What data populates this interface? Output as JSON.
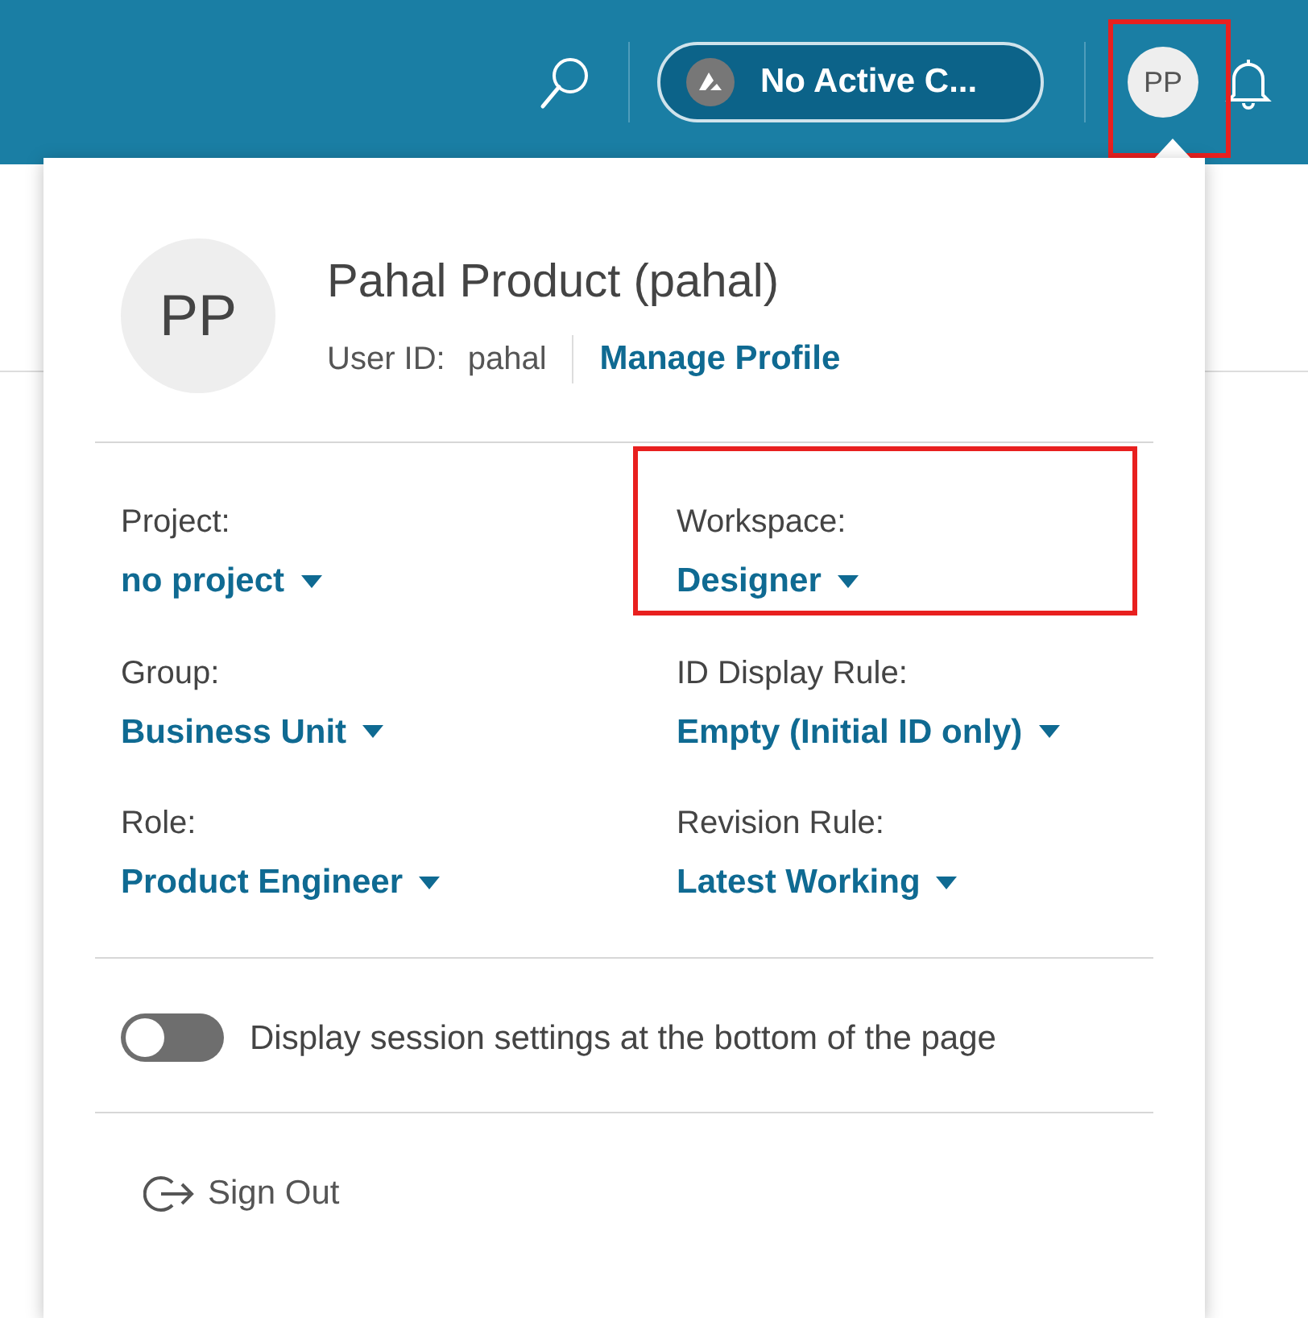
{
  "header": {
    "context_chip": {
      "label": "No Active C..."
    },
    "user_avatar": {
      "initials": "PP",
      "highlighted": true
    }
  },
  "profile": {
    "initials": "PP",
    "name": "Pahal Product (pahal)",
    "user_id_label": "User ID:",
    "user_id": "pahal",
    "manage_link": "Manage Profile"
  },
  "settings": [
    {
      "label": "Project:",
      "value": "no project",
      "highlighted": false
    },
    {
      "label": "Workspace:",
      "value": "Designer",
      "highlighted": true
    },
    {
      "label": "Group:",
      "value": "Business Unit",
      "highlighted": false
    },
    {
      "label": "ID Display Rule:",
      "value": "Empty (Initial ID only)",
      "highlighted": false
    },
    {
      "label": "Role:",
      "value": "Product Engineer",
      "highlighted": false
    },
    {
      "label": "Revision Rule:",
      "value": "Latest Working",
      "highlighted": false
    }
  ],
  "session_toggle": {
    "label": "Display session settings at the bottom of the page",
    "on": false
  },
  "sign_out": {
    "label": "Sign Out"
  }
}
